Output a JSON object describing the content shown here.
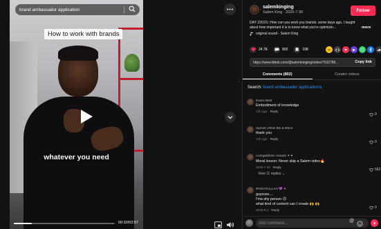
{
  "player": {
    "search_text": "brand ambassador application",
    "overlay_title": "How to work with brands",
    "caption": "whatever you need",
    "current_time": "00:32/02:57",
    "progress_fraction": 0.18
  },
  "author": {
    "username": "salemkinging",
    "subtitle": "Salem King · 2025-7-30",
    "follow_label": "Follow"
  },
  "description": {
    "text": "DAY 23/101: How can you work you brands. some days ago, I taught about how important it is to know what you're optimizin...",
    "more_label": "more",
    "sound": "original sound - Salem King"
  },
  "stats": {
    "likes": "24.7K",
    "comments": "802",
    "saves": "10K"
  },
  "share": {
    "link": "https://www.tiktok.com/@salemkinging/video/7532789...",
    "copy_label": "Copy link"
  },
  "tabs": [
    {
      "label": "Comments (802)",
      "active": true
    },
    {
      "label": "Creator videos",
      "active": false
    }
  ],
  "search_hint": {
    "prefix": "Search: ",
    "query": "brand ambassador application"
  },
  "comments": [
    {
      "name": "Evans Best",
      "text": "Embodiment of knowledge",
      "time": "12h ago",
      "reply": "Reply",
      "likes": "0"
    },
    {
      "name": "Upmes | Mom Bis & Mons",
      "text": "thank you",
      "time": "12h ago",
      "reply": "Reply",
      "likes": "0"
    },
    {
      "name": "LivingwithIdo~Joseph ✦ ♥",
      "text": "Moral lesson: Never skip a Salem video🔥",
      "time": "2025-7-30",
      "reply": "Reply",
      "likes": "662",
      "view_replies": "View 11 replies ⌄"
    },
    {
      "name": "IRODATULLAH 💜 ✦",
      "text": "guyssss....",
      "text2": "I'ma shy person 😊",
      "text3": "what kind of content can I create 🙌 🙌",
      "time": "2025-8-1",
      "reply": "Reply",
      "likes": "0"
    }
  ],
  "composer": {
    "placeholder": "Add comment..."
  },
  "colors": {
    "accent": "#fe2c55",
    "link": "#2f8ff0",
    "background": "#121212"
  }
}
